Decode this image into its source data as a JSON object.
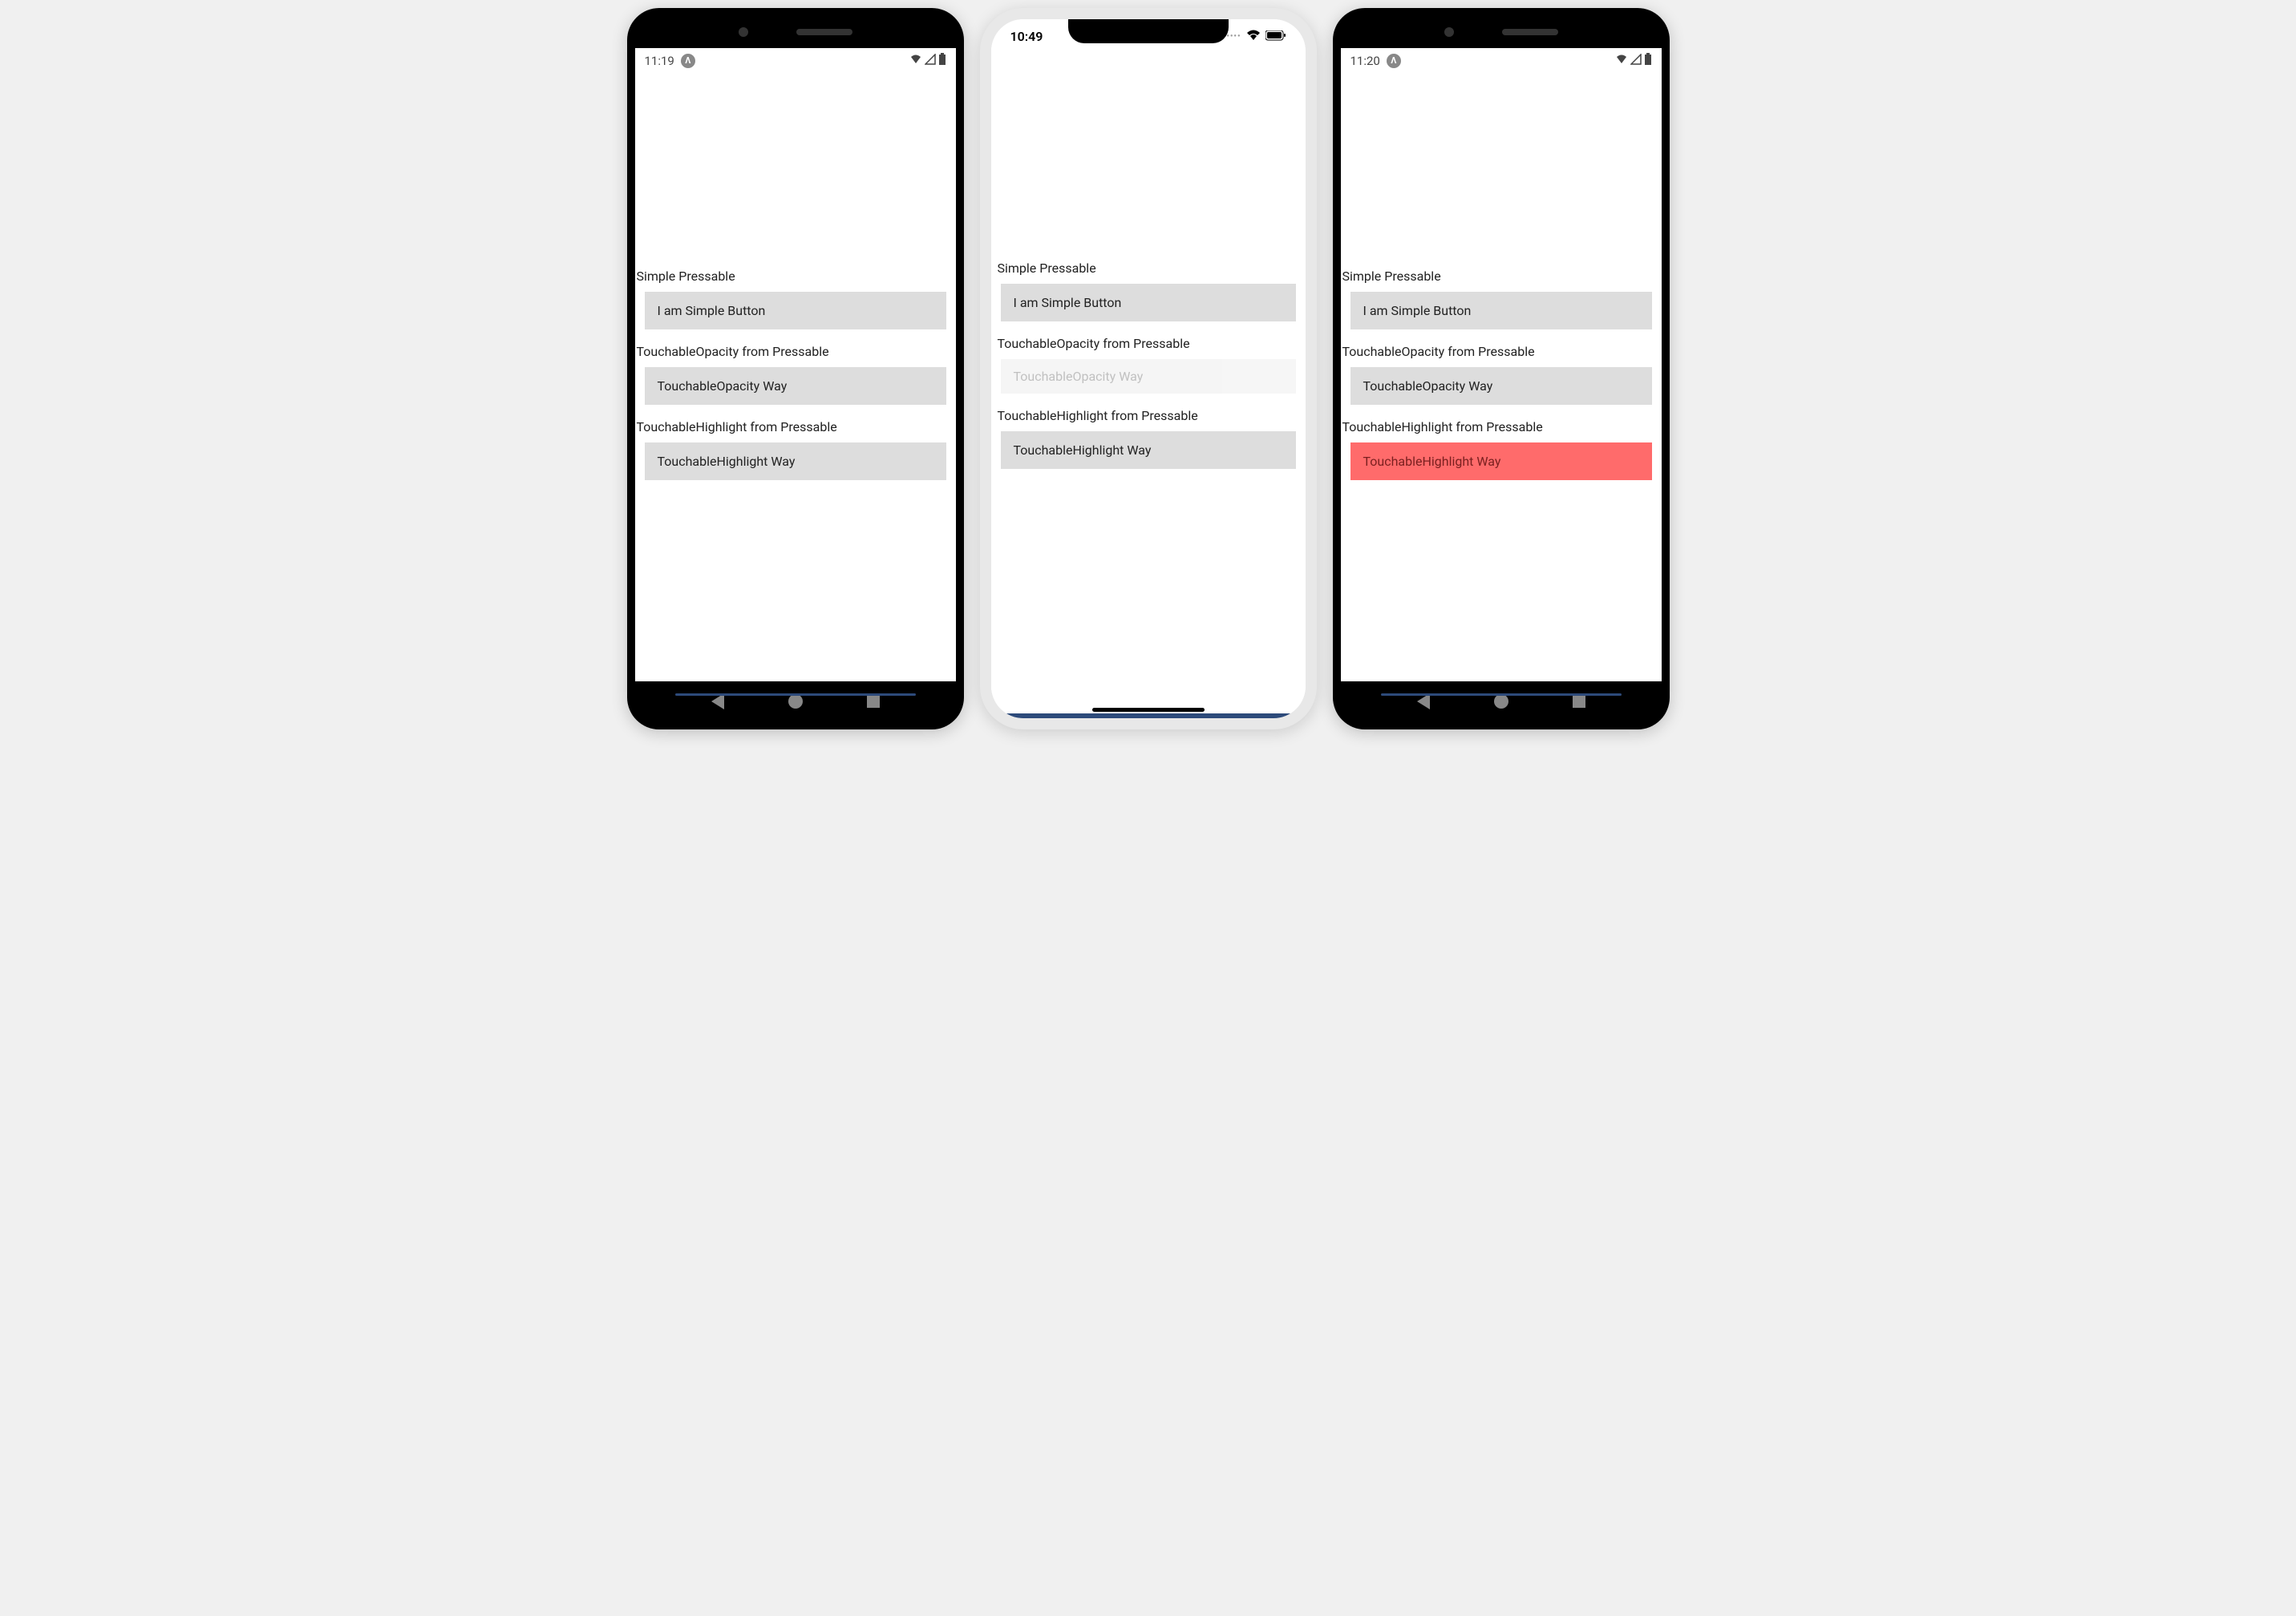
{
  "phones": [
    {
      "platform": "android",
      "status_time": "11:19",
      "sections": [
        {
          "label": "Simple Pressable",
          "button": "I am Simple Button",
          "state": "normal"
        },
        {
          "label": "TouchableOpacity from Pressable",
          "button": "TouchableOpacity Way",
          "state": "normal"
        },
        {
          "label": "TouchableHighlight from Pressable",
          "button": "TouchableHighlight Way",
          "state": "normal"
        }
      ]
    },
    {
      "platform": "ios",
      "status_time": "10:49",
      "sections": [
        {
          "label": "Simple Pressable",
          "button": "I am Simple Button",
          "state": "normal"
        },
        {
          "label": "TouchableOpacity from Pressable",
          "button": "TouchableOpacity Way",
          "state": "faded"
        },
        {
          "label": "TouchableHighlight from Pressable",
          "button": "TouchableHighlight Way",
          "state": "normal"
        }
      ]
    },
    {
      "platform": "android",
      "status_time": "11:20",
      "sections": [
        {
          "label": "Simple Pressable",
          "button": "I am Simple Button",
          "state": "normal"
        },
        {
          "label": "TouchableOpacity from Pressable",
          "button": "TouchableOpacity Way",
          "state": "normal"
        },
        {
          "label": "TouchableHighlight from Pressable",
          "button": "TouchableHighlight Way",
          "state": "highlighted"
        }
      ]
    }
  ],
  "expo_glyph": "Λ"
}
